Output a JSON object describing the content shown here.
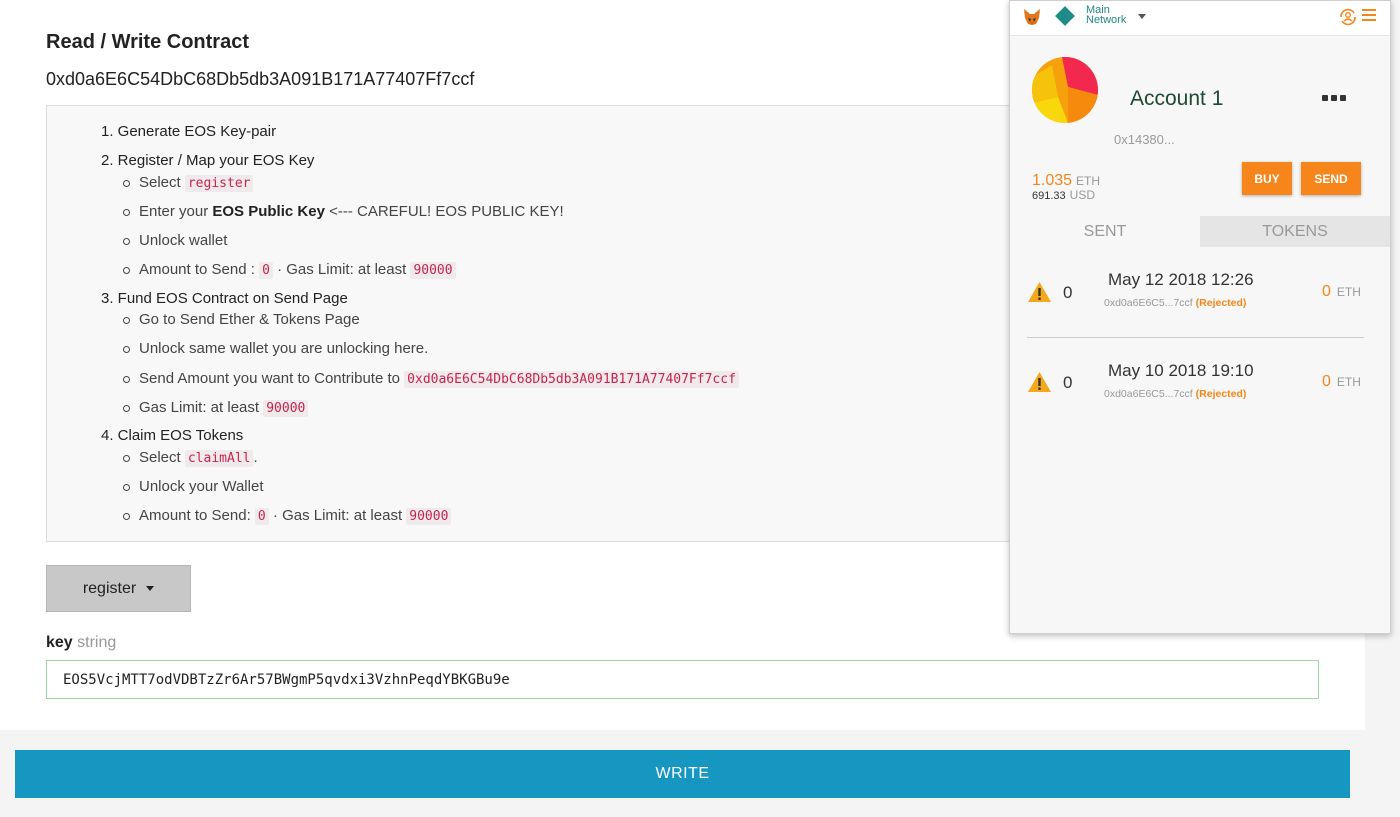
{
  "contract": {
    "title": "Read / Write Contract",
    "address": "0xd0a6E6C54DbC68Db5db3A091B171A77407Ff7ccf"
  },
  "instructions": {
    "step1": "1. Generate EOS Key-pair",
    "step2": "2. Register / Map your EOS Key",
    "s2_select_pre": "Select ",
    "s2_select_code": "register",
    "s2_enter_pre": "Enter your ",
    "s2_enter_bold": "EOS Public Key",
    "s2_enter_post": " <--- CAREFUL! EOS PUBLIC KEY!",
    "s2_unlock": "Unlock wallet",
    "s2_amount_pre": "Amount to Send : ",
    "s2_amount_code": "0",
    "s2_gas_pre": " · Gas Limit: at least ",
    "s2_gas_code": "90000",
    "step3": "3. Fund EOS Contract on Send Page",
    "s3_goto": "Go to Send Ether & Tokens Page",
    "s3_unlock": "Unlock same wallet you are unlocking here.",
    "s3_send_pre": "Send Amount you want to Contribute to ",
    "s3_send_code": "0xd0a6E6C54DbC68Db5db3A091B171A77407Ff7ccf",
    "s3_gas_pre": "Gas Limit: at least ",
    "s3_gas_code": "90000",
    "step4": "4. Claim EOS Tokens",
    "s4_select_pre": "Select ",
    "s4_select_code": "claimAll",
    "s4_select_post": ".",
    "s4_unlock": "Unlock your Wallet",
    "s4_amount_pre": "Amount to Send: ",
    "s4_amount_code": "0",
    "s4_gas_pre": " · Gas Limit: at least ",
    "s4_gas_code": "90000"
  },
  "function_select": {
    "value": "register"
  },
  "key_field": {
    "name": "key",
    "type": "string",
    "value": "EOS5VcjMTT7odVDBTzZr6Ar57BWgmP5qvdxi3VzhnPeqdYBKGBu9e"
  },
  "write_button": "WRITE",
  "metamask": {
    "network_line1": "Main",
    "network_line2": "Network",
    "account_name": "Account 1",
    "account_address": "0x14380...",
    "eth_balance": "1.035",
    "eth_unit": "ETH",
    "usd_balance": "691.33",
    "usd_unit": "USD",
    "buy_label": "BUY",
    "send_label": "SEND",
    "tab_sent": "SENT",
    "tab_tokens": "TOKENS",
    "accent_color": "#f6851b",
    "network_color": "#1e8c86",
    "transactions": [
      {
        "nonce": "0",
        "date": "May 12 2018 12:26",
        "to": "0xd0a6E6C5...7ccf",
        "status": "(Rejected)",
        "amount": "0",
        "unit": "ETH"
      },
      {
        "nonce": "0",
        "date": "May 10 2018 19:10",
        "to": "0xd0a6E6C5...7ccf",
        "status": "(Rejected)",
        "amount": "0",
        "unit": "ETH"
      }
    ]
  },
  "colors": {
    "write_button": "#1597c2",
    "code_text": "#c7254e"
  }
}
